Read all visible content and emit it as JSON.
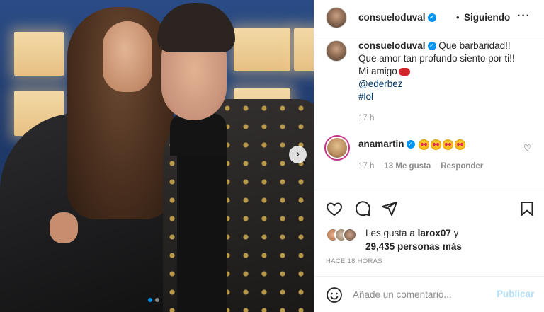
{
  "post": {
    "username": "consueloduval",
    "separator": "•",
    "follow_label": "Siguiendo",
    "more_label": "···"
  },
  "caption": {
    "username": "consueloduval",
    "line1": "Que barbaridad!!",
    "line2": "Que amor tan profundo siento por ti!!",
    "line3": "Mi amigo",
    "mention": "@ederbez",
    "hashtag": "#lol",
    "time": "17 h"
  },
  "comment": {
    "username": "anamartin",
    "time": "17 h",
    "likes": "13 Me gusta",
    "reply_label": "Responder"
  },
  "likes": {
    "prefix": "Les gusta a",
    "user": "larox07",
    "connector": "y",
    "count": "29,435 personas más"
  },
  "timestamp": "HACE 18 HORAS",
  "composer": {
    "placeholder": "Añade un comentario...",
    "publish_label": "Publicar"
  },
  "carousel": {
    "total_slides": 2,
    "active_slide": 1
  },
  "colors": {
    "accent": "#0095f6",
    "link": "#00376b",
    "muted": "#8e8e8e",
    "publish_disabled": "#b2dffc"
  }
}
